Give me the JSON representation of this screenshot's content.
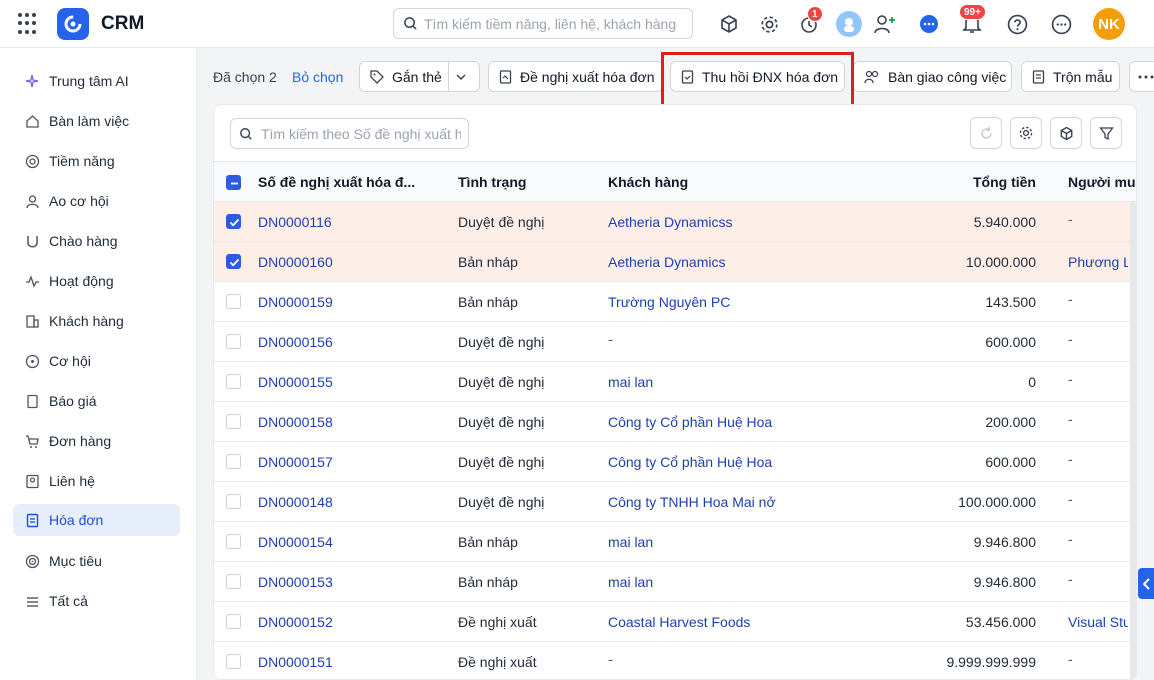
{
  "app": {
    "name": "CRM",
    "search_placeholder": "Tìm kiếm tiềm năng, liên hệ, khách hàng",
    "timer_badge": "1",
    "notif_badge": "99+",
    "avatar_initials": "NK"
  },
  "sidebar": {
    "items": [
      {
        "label": "Trung tâm AI",
        "icon": "sparkle-icon"
      },
      {
        "label": "Bàn làm việc",
        "icon": "home-icon"
      },
      {
        "label": "Tiềm năng",
        "icon": "target-icon"
      },
      {
        "label": "Ao cơ hội",
        "icon": "users-icon"
      },
      {
        "label": "Chào hàng",
        "icon": "magnet-icon"
      },
      {
        "label": "Hoạt động",
        "icon": "activity-icon"
      },
      {
        "label": "Khách hàng",
        "icon": "building-icon"
      },
      {
        "label": "Cơ hội",
        "icon": "coin-icon"
      },
      {
        "label": "Báo giá",
        "icon": "quote-icon"
      },
      {
        "label": "Đơn hàng",
        "icon": "cart-icon"
      },
      {
        "label": "Liên hệ",
        "icon": "contact-icon"
      },
      {
        "label": "Hóa đơn",
        "icon": "invoice-icon",
        "active": true
      },
      {
        "label": "Mục tiêu",
        "icon": "goal-icon"
      },
      {
        "label": "Tất cả",
        "icon": "menu-icon"
      }
    ]
  },
  "actionbar": {
    "selected_text": "Đã chọn 2",
    "unselect_label": "Bỏ chọn",
    "tag_label": "Gắn thẻ",
    "propose_label": "Đề nghị xuất hóa đơn",
    "revoke_label": "Thu hồi ĐNX hóa đơn",
    "handover_label": "Bàn giao công việc",
    "merge_label": "Trộn mẫu"
  },
  "table": {
    "search_placeholder": "Tìm kiếm theo Số đề nghị xuất h...",
    "headers": [
      "Số đề nghị xuất hóa đ...",
      "Tình trạng",
      "Khách hàng",
      "Tổng tiền",
      "Người mua"
    ],
    "rows": [
      {
        "code": "DN0000116",
        "status": "Duyệt đề nghị",
        "customer": "Aetheria Dynamicss",
        "total": "5.940.000",
        "buyer": "-",
        "checked": true
      },
      {
        "code": "DN0000160",
        "status": "Bản nháp",
        "customer": "Aetheria Dynamics",
        "total": "10.000.000",
        "buyer": "Phương Linh",
        "checked": true
      },
      {
        "code": "DN0000159",
        "status": "Bản nháp",
        "customer": "Trường Nguyên PC",
        "total": "143.500",
        "buyer": "-",
        "checked": false
      },
      {
        "code": "DN0000156",
        "status": "Duyệt đề nghị",
        "customer": "-",
        "total": "600.000",
        "buyer": "-",
        "checked": false
      },
      {
        "code": "DN0000155",
        "status": "Duyệt đề nghị",
        "customer": "mai lan",
        "total": "0",
        "buyer": "-",
        "checked": false
      },
      {
        "code": "DN0000158",
        "status": "Duyệt đề nghị",
        "customer": "Công ty Cổ phần Huệ Hoa",
        "total": "200.000",
        "buyer": "-",
        "checked": false
      },
      {
        "code": "DN0000157",
        "status": "Duyệt đề nghị",
        "customer": "Công ty Cổ phần Huệ Hoa",
        "total": "600.000",
        "buyer": "-",
        "checked": false
      },
      {
        "code": "DN0000148",
        "status": "Duyệt đề nghị",
        "customer": "Công ty TNHH Hoa Mai nở",
        "total": "100.000.000",
        "buyer": "-",
        "checked": false
      },
      {
        "code": "DN0000154",
        "status": "Bản nháp",
        "customer": "mai lan",
        "total": "9.946.800",
        "buyer": "-",
        "checked": false
      },
      {
        "code": "DN0000153",
        "status": "Bản nháp",
        "customer": "mai lan",
        "total": "9.946.800",
        "buyer": "-",
        "checked": false
      },
      {
        "code": "DN0000152",
        "status": "Đề nghị xuất",
        "customer": "Coastal Harvest Foods",
        "total": "53.456.000",
        "buyer": "Visual Studio",
        "checked": false
      },
      {
        "code": "DN0000151",
        "status": "Đề nghị xuất",
        "customer": "-",
        "total": "9.999.999.999",
        "buyer": "-",
        "checked": false
      }
    ]
  },
  "colors": {
    "accent": "#2563eb",
    "selected_row": "#fdefe8",
    "highlight": "#e11d1d",
    "avatar": "#f59e0b"
  }
}
